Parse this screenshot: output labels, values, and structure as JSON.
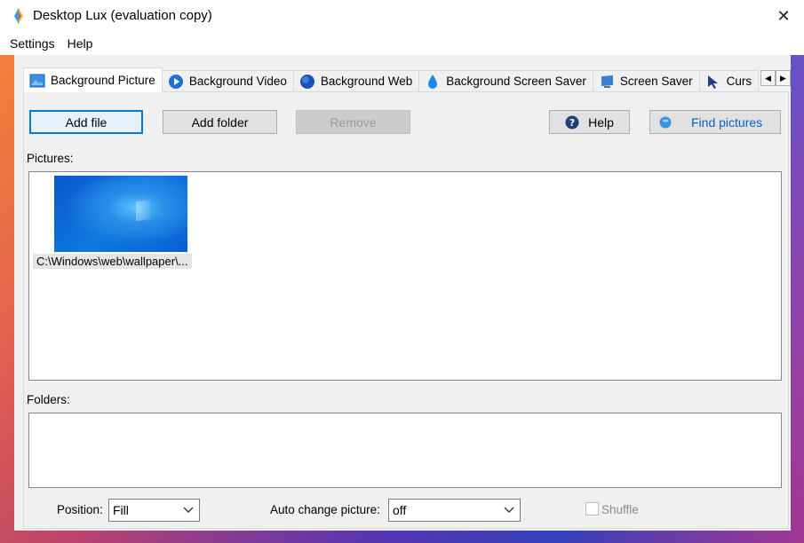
{
  "window": {
    "title": "Desktop Lux (evaluation copy)",
    "close_glyph": "✕"
  },
  "menu": [
    "Settings",
    "Help"
  ],
  "tabs": [
    {
      "label": "Background Picture",
      "icon": "picture-icon",
      "active": true
    },
    {
      "label": "Background Video",
      "icon": "play-video-icon"
    },
    {
      "label": "Background Web",
      "icon": "globe-icon"
    },
    {
      "label": "Background Screen Saver",
      "icon": "water-drop-icon"
    },
    {
      "label": "Screen Saver",
      "icon": "monitor-icon"
    },
    {
      "label": "Curs",
      "icon": "cursor-arrow-icon"
    }
  ],
  "tab_scroll": {
    "left": "◀",
    "right": "▶"
  },
  "toolbar": {
    "add_file": "Add file",
    "add_folder": "Add folder",
    "remove": "Remove",
    "help": "Help",
    "find_pictures": "Find pictures"
  },
  "pictures": {
    "label": "Pictures:",
    "items": [
      {
        "caption": "C:\\Windows\\web\\wallpaper\\..."
      }
    ]
  },
  "folders": {
    "label": "Folders:"
  },
  "bottom": {
    "position_label": "Position:",
    "position_value": "Fill",
    "auto_change_label": "Auto change picture:",
    "auto_change_value": "off",
    "shuffle_label": "Shuffle",
    "shuffle_checked": false
  },
  "colors": {
    "accent": "#0078d7",
    "find_pictures_text": "#0a5fc8"
  }
}
